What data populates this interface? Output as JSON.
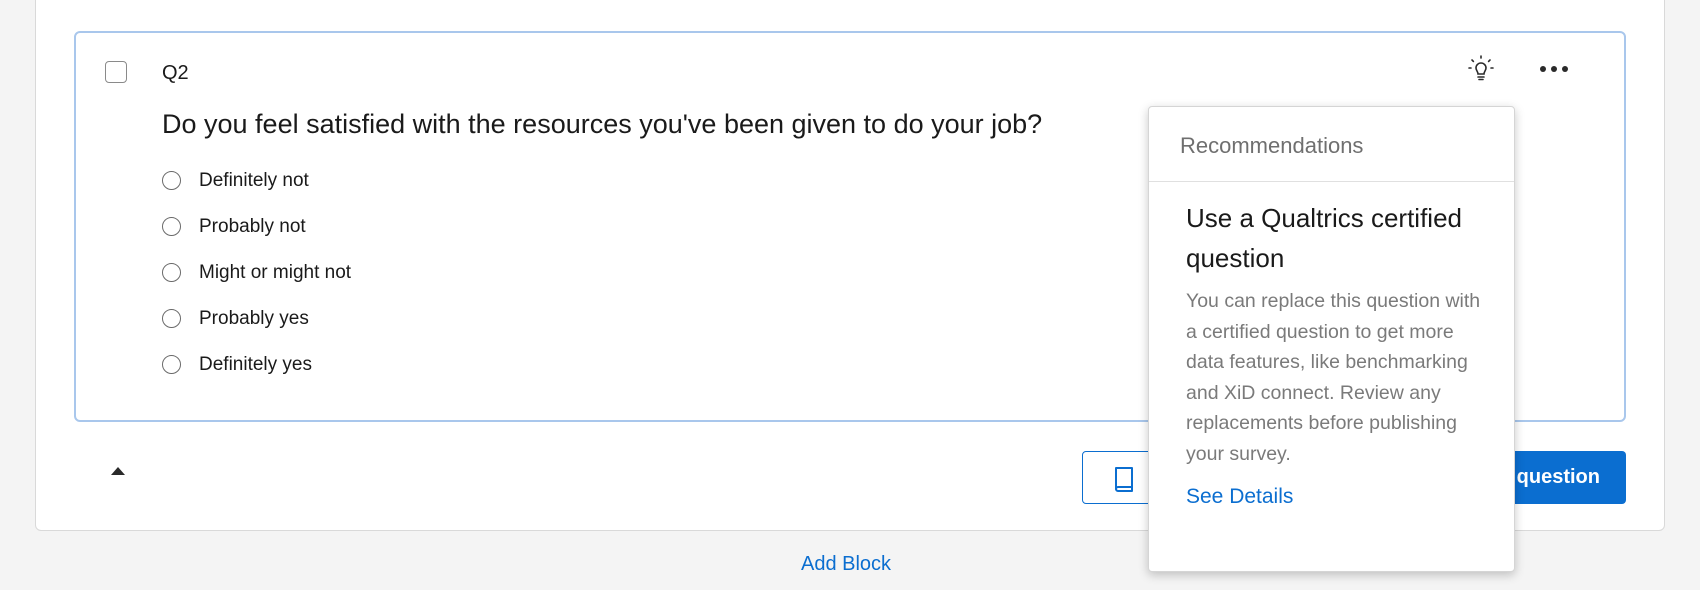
{
  "question": {
    "id": "Q2",
    "text": "Do you feel satisfied with the resources you've been given to do your job?",
    "choices": [
      "Definitely not",
      "Probably not",
      "Might or might not",
      "Probably yes",
      "Definitely yes"
    ]
  },
  "toolbar": {
    "recommendations_icon": "lightbulb-icon",
    "more_icon": "more-horizontal-icon"
  },
  "footer": {
    "library_icon": "book-icon",
    "add_question_label": "question",
    "add_block_label": "Add Block"
  },
  "recommendations": {
    "header": "Recommendations",
    "title": "Use a Qualtrics certified question",
    "description": "You can replace this question with a certified question to get more data features, like benchmarking and XiD connect. Review any replacements before publishing your survey.",
    "link": "See Details"
  },
  "colors": {
    "accent": "#0b6ed0",
    "selected_border": "#a9c7ec",
    "background": "#f4f4f4"
  }
}
